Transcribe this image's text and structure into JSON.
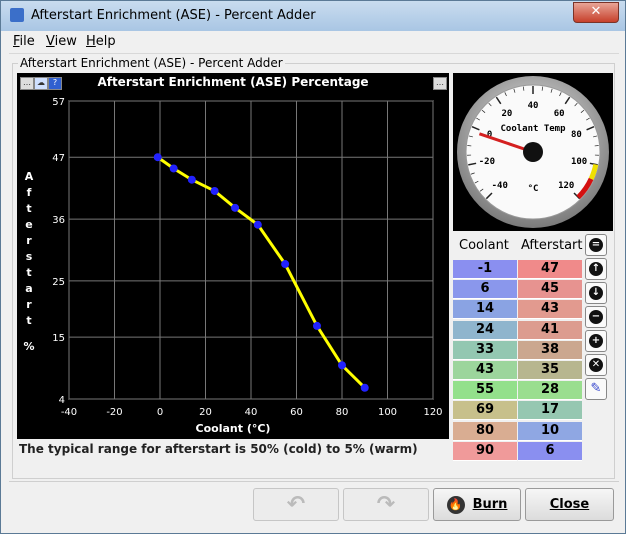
{
  "window": {
    "title": "Afterstart Enrichment (ASE) - Percent Adder",
    "close_label": "✕"
  },
  "menu": {
    "file": "File",
    "view": "View",
    "help": "Help"
  },
  "panel": {
    "title": "Afterstart Enrichment (ASE) - Percent Adder"
  },
  "chart_data": {
    "type": "line",
    "title": "Afterstart Enrichment (ASE) Percentage",
    "xlabel": "Coolant (°C)",
    "ylabel": "Afterstart %",
    "x": [
      -1,
      6,
      14,
      24,
      33,
      43,
      55,
      69,
      80,
      90
    ],
    "y": [
      47,
      45,
      43,
      41,
      38,
      35,
      28,
      17,
      10,
      6
    ],
    "xlim": [
      -40,
      120
    ],
    "ylim": [
      4,
      57
    ],
    "xticks": [
      "-40",
      "-20",
      "0",
      "20",
      "40",
      "60",
      "80",
      "100",
      "120"
    ],
    "yticks": [
      "57",
      "47",
      "36",
      "25",
      "15",
      "4"
    ],
    "grid": true,
    "line_color": "#ffff00",
    "point_color": "#2222ff"
  },
  "gauge": {
    "label": "Coolant Temp",
    "unit": "°C",
    "ticks": [
      "-40",
      "-20",
      "0",
      "20",
      "40",
      "60",
      "80",
      "100",
      "120"
    ],
    "value": 0
  },
  "table": {
    "headers": [
      "Coolant",
      "Afterstart"
    ],
    "coolant": [
      "-1",
      "6",
      "14",
      "24",
      "33",
      "43",
      "55",
      "69",
      "80",
      "90"
    ],
    "afterstart": [
      "47",
      "45",
      "43",
      "41",
      "38",
      "35",
      "28",
      "17",
      "10",
      "6"
    ],
    "coolant_colors": [
      "#8a8ff0",
      "#8a97ec",
      "#8aa3e3",
      "#8fb5cd",
      "#93c7b1",
      "#9cd59c",
      "#93e08b",
      "#c7c08b",
      "#d9ad92",
      "#f09a9a"
    ],
    "afterstart_colors": [
      "#f08a8a",
      "#e79390",
      "#e29a8f",
      "#dc9c8f",
      "#cba78f",
      "#b7b68f",
      "#9ade8f",
      "#96c7b1",
      "#8fa7e3",
      "#8a8ff0"
    ]
  },
  "side_buttons": [
    "=",
    "↑",
    "↓",
    "−",
    "+",
    "✕",
    "✎"
  ],
  "info": "The typical range for afterstart is 50% (cold) to 5% (warm)",
  "buttons": {
    "undo": "↶",
    "redo": "↷",
    "burn": "Burn",
    "close": "Close"
  }
}
